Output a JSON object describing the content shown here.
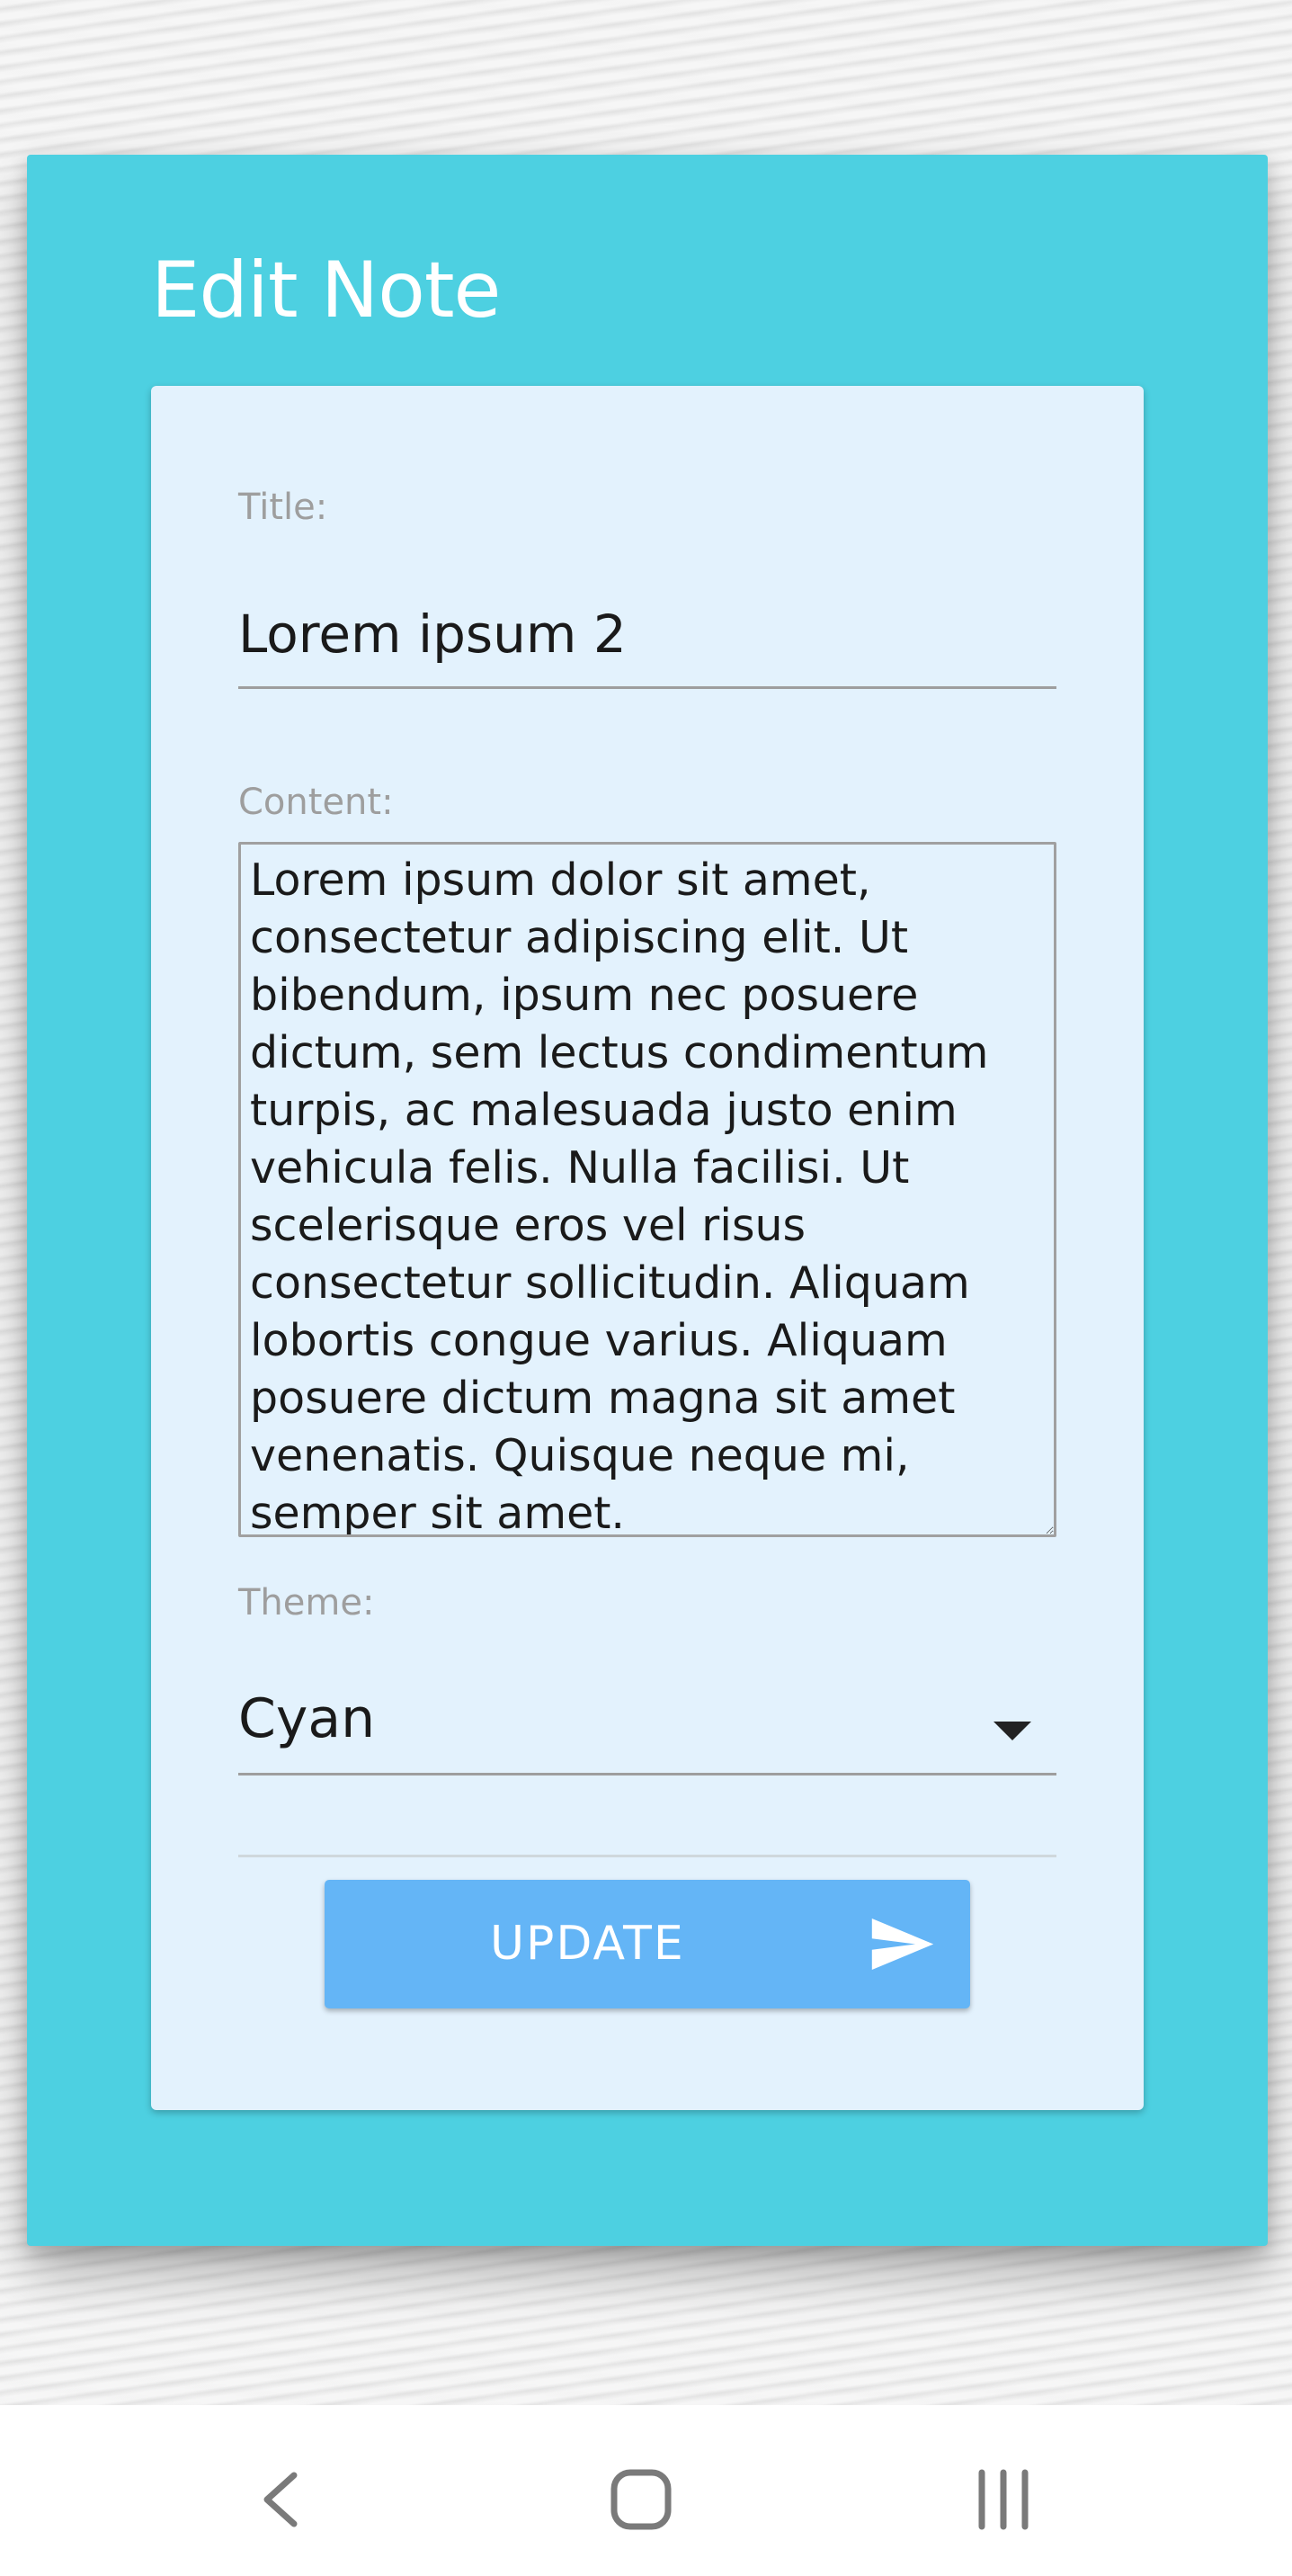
{
  "page": {
    "title": "Edit Note"
  },
  "form": {
    "title_label": "Title:",
    "title_value": "Lorem ipsum 2",
    "content_label": "Content:",
    "content_value": "Lorem ipsum dolor sit amet, consectetur adipiscing elit. Ut bibendum, ipsum nec posuere dictum, sem lectus condimentum turpis, ac malesuada justo enim vehicula felis. Nulla facilisi. Ut scelerisque eros vel risus consectetur sollicitudin. Aliquam lobortis congue varius. Aliquam posuere dictum magna sit amet venenatis. Quisque neque mi, semper sit amet.",
    "theme_label": "Theme:",
    "theme_value": "Cyan",
    "update_label": "UPDATE"
  },
  "icons": {
    "dropdown": "chevron-down-icon",
    "submit": "send-icon",
    "nav_back": "back-icon",
    "nav_home": "home-icon",
    "nav_recents": "recents-icon"
  },
  "colors": {
    "panel": "#4dd0e1",
    "card": "#e3f2fd",
    "button": "#64b5f6",
    "label": "#9e9e9e"
  }
}
